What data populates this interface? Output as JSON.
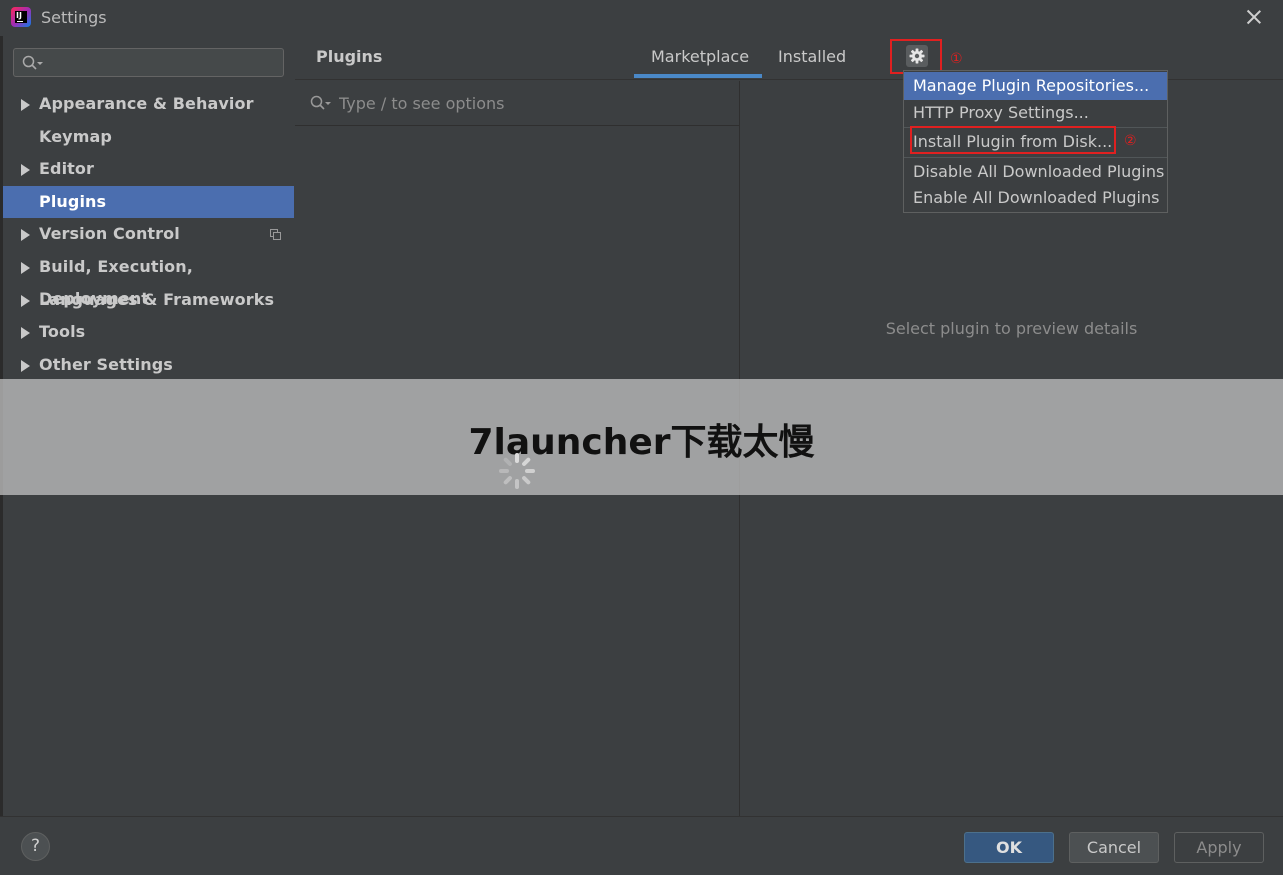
{
  "window": {
    "title": "Settings"
  },
  "sidebar": {
    "search_placeholder": "",
    "items": [
      {
        "label": "Appearance & Behavior",
        "expandable": true
      },
      {
        "label": "Keymap",
        "expandable": false
      },
      {
        "label": "Editor",
        "expandable": true
      },
      {
        "label": "Plugins",
        "expandable": false,
        "selected": true
      },
      {
        "label": "Version Control",
        "expandable": true
      },
      {
        "label": "Build, Execution, Deployment",
        "expandable": true
      },
      {
        "label": "Languages & Frameworks",
        "expandable": true
      },
      {
        "label": "Tools",
        "expandable": true
      },
      {
        "label": "Other Settings",
        "expandable": true
      }
    ]
  },
  "header": {
    "title": "Plugins",
    "tabs": [
      {
        "label": "Marketplace",
        "active": true
      },
      {
        "label": "Installed",
        "active": false
      }
    ],
    "annotation_1": "①"
  },
  "list": {
    "search_placeholder": "Type / to see options"
  },
  "details": {
    "placeholder": "Select plugin to preview details"
  },
  "menu": {
    "items": [
      {
        "label": "Manage Plugin Repositories..."
      },
      {
        "label": "HTTP Proxy Settings..."
      },
      {
        "label": "Install Plugin from Disk..."
      },
      {
        "label": "Disable All Downloaded Plugins"
      },
      {
        "label": "Enable All Downloaded Plugins"
      }
    ],
    "annotation_2": "②"
  },
  "banner": {
    "text": "7launcher下载太慢"
  },
  "footer": {
    "help": "?",
    "ok": "OK",
    "cancel": "Cancel",
    "apply": "Apply"
  },
  "colors": {
    "background": "#3c3f41",
    "selection": "#4b6eaf",
    "accent_tab": "#4a88c7",
    "annotation_red": "#e02020",
    "ok_button": "#365880"
  }
}
